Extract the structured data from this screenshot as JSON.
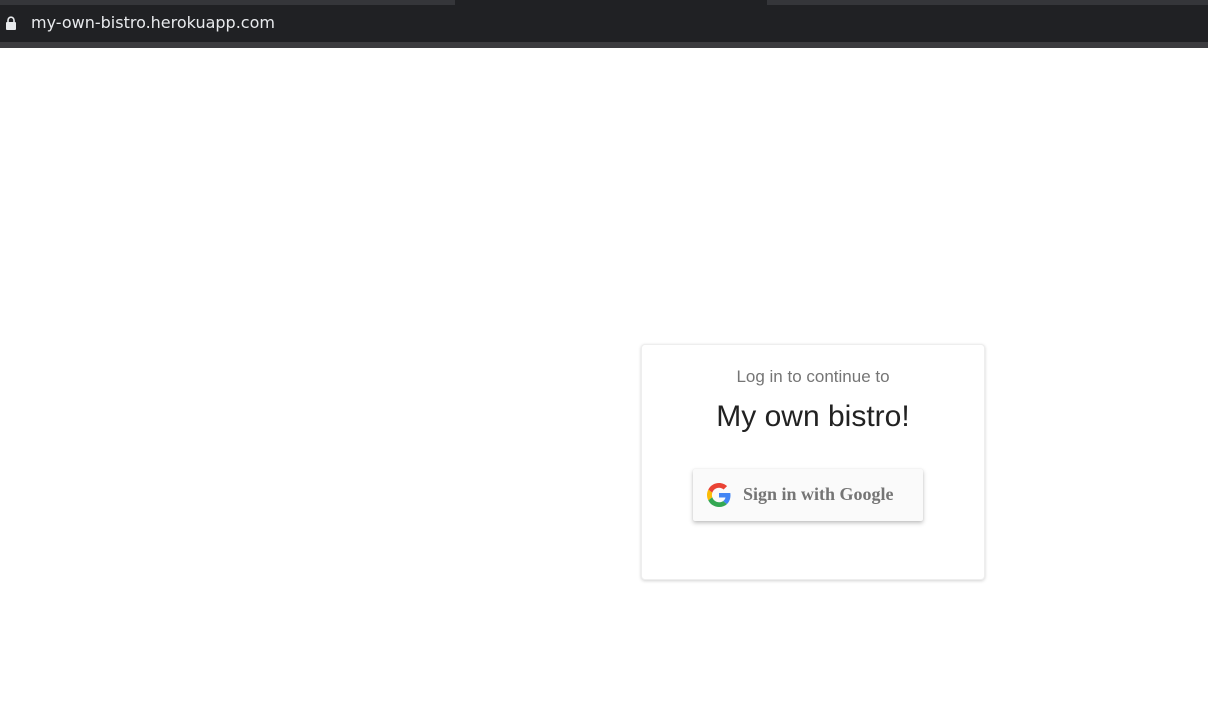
{
  "browser": {
    "url": "my-own-bistro.herokuapp.com",
    "lock_icon": "lock-icon"
  },
  "login": {
    "subtitle": "Log in to continue to",
    "title": "My own bistro!",
    "google_button": {
      "label": "Sign in with Google",
      "icon": "google-icon"
    }
  },
  "colors": {
    "browser_bar": "#202124",
    "url_text": "#e8eaed",
    "subtitle_text": "#757575",
    "title_text": "#222222",
    "button_text": "#757575",
    "google_blue": "#4285F4",
    "google_red": "#EA4335",
    "google_yellow": "#FBBC05",
    "google_green": "#34A853"
  }
}
